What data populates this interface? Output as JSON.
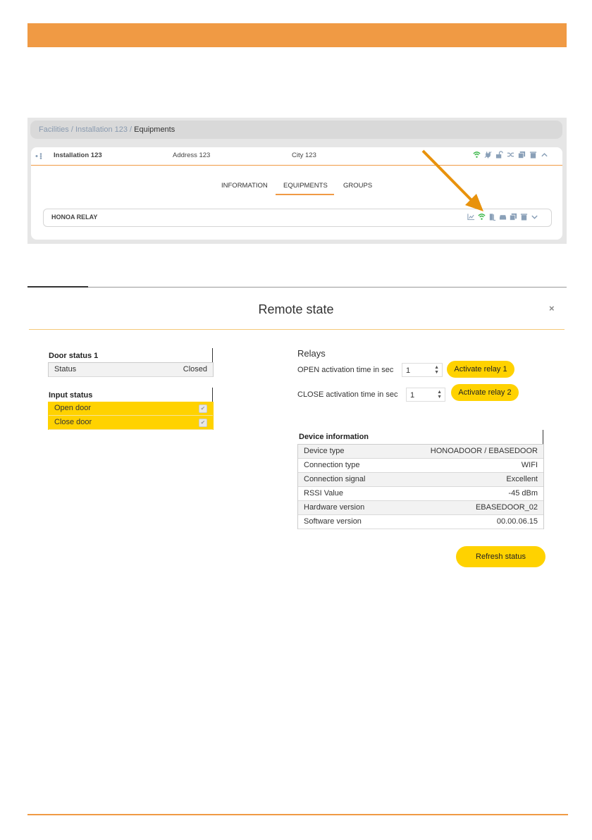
{
  "breadcrumb": {
    "part1": "Facilities",
    "sep": " / ",
    "part2": "Installation 123",
    "part3": "Equipments"
  },
  "installation": {
    "name": "Installation 123",
    "address": "Address 123",
    "city": "City 123"
  },
  "tabs": [
    "INFORMATION",
    "EQUIPMENTS",
    "GROUPS"
  ],
  "active_tab": "EQUIPMENTS",
  "equipment": {
    "name": "HONOA RELAY"
  },
  "modal": {
    "title": "Remote state",
    "close": "×"
  },
  "door_status": {
    "title": "Door status 1",
    "rows": [
      {
        "label": "Status",
        "value": "Closed"
      }
    ]
  },
  "input_status": {
    "title": "Input status",
    "rows": [
      {
        "label": "Open door",
        "checked": true
      },
      {
        "label": "Close door",
        "checked": true
      }
    ]
  },
  "relays": {
    "title": "Relays",
    "open_label": "OPEN activation time in sec",
    "open_value": "1",
    "open_button": "Activate relay 1",
    "close_label": "CLOSE activation time in sec",
    "close_value": "1",
    "close_button": "Activate relay 2"
  },
  "device_info": {
    "title": "Device information",
    "rows": [
      {
        "label": "Device type",
        "value": "HONOADOOR / EBASEDOOR"
      },
      {
        "label": "Connection type",
        "value": "WIFI"
      },
      {
        "label": "Connection signal",
        "value": "Excellent"
      },
      {
        "label": "RSSI Value",
        "value": "-45 dBm"
      },
      {
        "label": "Hardware version",
        "value": "EBASEDOOR_02"
      },
      {
        "label": "Software version",
        "value": "00.00.06.15"
      }
    ]
  },
  "refresh_button": "Refresh status",
  "colors": {
    "accent_orange": "#f09a44",
    "button_yellow": "#ffd200",
    "wifi_green": "#3cb84a"
  }
}
